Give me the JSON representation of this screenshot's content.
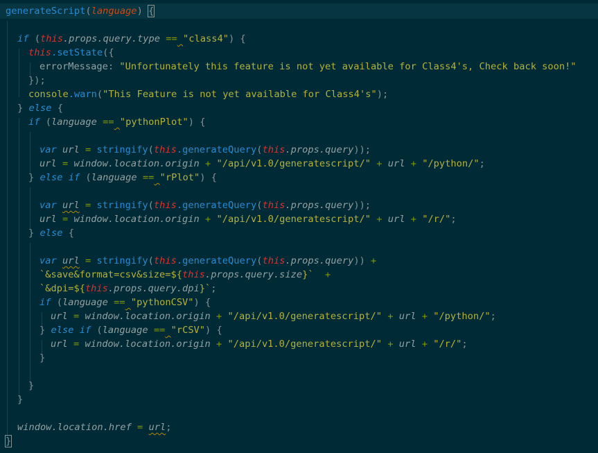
{
  "code": {
    "l1": {
      "fn": "generateScript",
      "p1": "(",
      "param": "language",
      "p2": ")",
      "brace": "{"
    },
    "l3": {
      "kw": "if",
      "p1": " (",
      "this": "this",
      "prop": ".props.query.type",
      "op": " ==",
      "sp": " ",
      "str": "\"class4\"",
      "p2": ") {"
    },
    "l4": {
      "this": "this",
      "method": ".setState",
      "p1": "({"
    },
    "l5": {
      "key": "errorMessage",
      "p1": ": ",
      "str": "\"Unfortunately this feature is not yet available for Class4's, Check back soon!\""
    },
    "l6": {
      "p1": "});"
    },
    "l7": {
      "obj": "console",
      "method": ".warn",
      "p1": "(",
      "str": "\"This Feature is not yet available for Class4's\"",
      "p2": ");"
    },
    "l8": {
      "p1": "} ",
      "kw": "else",
      "p2": " {"
    },
    "l9": {
      "kw": "if",
      "p1": " (",
      "var": "language",
      "op": " ==",
      "sp": " ",
      "str": "\"pythonPlot\"",
      "p2": ") {"
    },
    "l11": {
      "kw": "var",
      "sp1": " ",
      "var": "url",
      "op": " = ",
      "fn": "stringify",
      "p1": "(",
      "this1": "this",
      "method": ".generateQuery",
      "p2": "(",
      "this2": "this",
      "prop": ".props.query",
      "p3": "));"
    },
    "l12": {
      "var": "url",
      "op1": " = ",
      "prop": "window.location.origin",
      "op2": " + ",
      "str1": "\"/api/v1.0/generatescript/\"",
      "op3": " + ",
      "var2": "url",
      "op4": " + ",
      "str2": "\"/python/\"",
      "p1": ";"
    },
    "l13": {
      "p1": "} ",
      "kw1": "else",
      "sp": " ",
      "kw2": "if",
      "p2": " (",
      "var": "language",
      "op": " ==",
      "sp2": " ",
      "str": "\"rPlot\"",
      "p3": ") {"
    },
    "l15": {
      "kw": "var",
      "sp1": " ",
      "var": "url",
      "op": " = ",
      "fn": "stringify",
      "p1": "(",
      "this1": "this",
      "method": ".generateQuery",
      "p2": "(",
      "this2": "this",
      "prop": ".props.query",
      "p3": "));"
    },
    "l16": {
      "var": "url",
      "op1": " = ",
      "prop": "window.location.origin",
      "op2": " + ",
      "str1": "\"/api/v1.0/generatescript/\"",
      "op3": " + ",
      "var2": "url",
      "op4": " + ",
      "str2": "\"/r/\"",
      "p1": ";"
    },
    "l17": {
      "p1": "} ",
      "kw": "else",
      "p2": " {"
    },
    "l19": {
      "kw": "var",
      "sp1": " ",
      "var": "url",
      "op": " = ",
      "fn": "stringify",
      "p1": "(",
      "this1": "this",
      "method": ".generateQuery",
      "p2": "(",
      "this2": "this",
      "prop": ".props.query",
      "p3": "))",
      "op2": " +"
    },
    "l20": {
      "tpl1": "`&save&format=csv&size=${",
      "this": "this",
      "prop": ".props.query.size",
      "tpl2": "}`",
      "op": "  +"
    },
    "l21": {
      "tpl1": "`&dpi=${",
      "this": "this",
      "prop": ".props.query.dpi",
      "tpl2": "}`",
      "p1": ";"
    },
    "l22": {
      "kw": "if",
      "p1": " (",
      "var": "language",
      "op": " ==",
      "sp": " ",
      "str": "\"pythonCSV\"",
      "p2": ") {"
    },
    "l23": {
      "var": "url",
      "op1": " = ",
      "prop": "window.location.origin",
      "op2": " + ",
      "str1": "\"/api/v1.0/generatescript/\"",
      "op3": " + ",
      "var2": "url",
      "op4": " + ",
      "str2": "\"/python/\"",
      "p1": ";"
    },
    "l24": {
      "p1": "} ",
      "kw1": "else",
      "sp": " ",
      "kw2": "if",
      "p2": " (",
      "var": "language",
      "op": " ==",
      "sp2": " ",
      "str": "\"rCSV\"",
      "p3": ") {"
    },
    "l25": {
      "var": "url",
      "op1": " = ",
      "prop": "window.location.origin",
      "op2": " + ",
      "str1": "\"/api/v1.0/generatescript/\"",
      "op3": " + ",
      "var2": "url",
      "op4": " + ",
      "str2": "\"/r/\"",
      "p1": ";"
    },
    "l26": {
      "p1": "}"
    },
    "l28": {
      "p1": "}"
    },
    "l29": {
      "p1": "}"
    },
    "l31": {
      "var": "window.location.href",
      "op": " = ",
      "var2": "url",
      "p1": ";"
    },
    "l32": {
      "p1": "}"
    }
  },
  "colors": {
    "background": "#002b36",
    "current_line": "#073642",
    "keyword": "#268bd2",
    "this": "#dc322f",
    "string": "#b5b23a",
    "param": "#cb4b16",
    "operator": "#859900",
    "squiggle": "#b58900"
  }
}
